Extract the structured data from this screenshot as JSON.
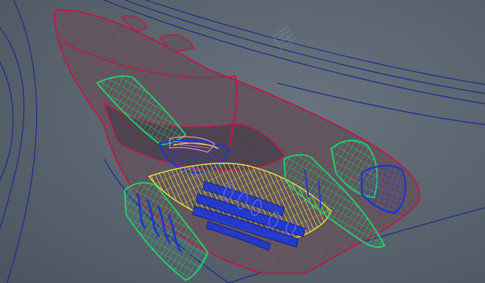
{
  "viewport": {
    "background": "#5b6570",
    "curve_color": "#1f2e8a",
    "wire_red": "#c0174a",
    "wire_green": "#1fd36a",
    "wire_yellow": "#e6e040",
    "wire_blue": "#1c34d8",
    "hull_fill": "#5e5860"
  },
  "watermark": {
    "text": "库"
  }
}
